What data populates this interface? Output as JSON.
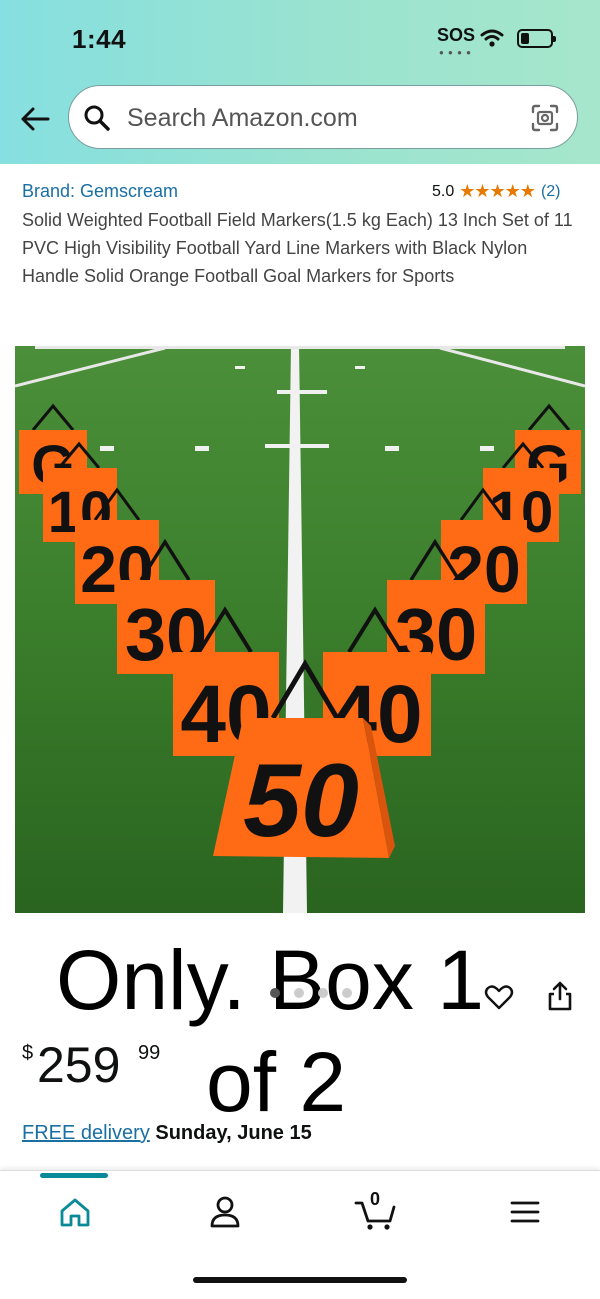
{
  "status_bar": {
    "time": "1:44",
    "carrier": "SOS",
    "icons": [
      "wifi-icon",
      "battery-icon"
    ]
  },
  "search": {
    "placeholder": "Search Amazon.com"
  },
  "product": {
    "brand": "Brand: Gemscream",
    "rating": "5.0",
    "stars": "★★★★★",
    "rating_count": "(2)",
    "title": "Solid Weighted Football Field Markers(1.5 kg Each) 13 Inch Set of 11 PVC High Visibility Football Yard Line Markers with Black Nylon Handle Solid Orange Football Goal Markers for Sports",
    "image_labels": [
      "G",
      "10",
      "20",
      "30",
      "40",
      "50",
      "40",
      "30",
      "20",
      "10",
      "G"
    ],
    "overlay": {
      "line1": "Only. Box 1",
      "line2": "of 2"
    },
    "carousel": {
      "count": 4,
      "active_index": 0
    },
    "price": {
      "symbol": "$",
      "whole": "259",
      "fraction": "99"
    },
    "delivery": {
      "link": "FREE delivery",
      "date": "Sunday, June 15"
    }
  },
  "bottom_nav": {
    "items": [
      "home-icon",
      "account-icon",
      "cart-icon",
      "menu-icon"
    ],
    "cart_count": "0",
    "accent": "#0a8a99"
  },
  "colors": {
    "header_gradient_start": "#86dfe0",
    "link": "#1a6fa3",
    "star": "#e67a00",
    "marker_orange": "#ff6a14",
    "field_green": "#2f7a24"
  }
}
